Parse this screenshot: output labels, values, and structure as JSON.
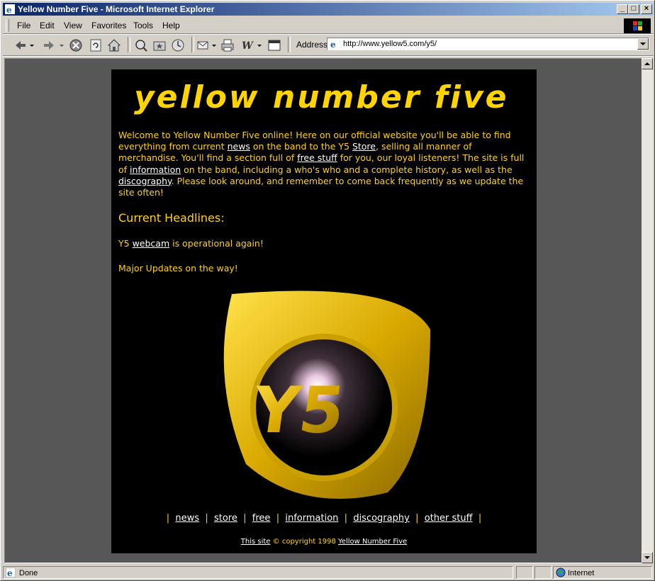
{
  "window": {
    "title": "Yellow Number Five - Microsoft Internet Explorer",
    "controls": {
      "minimize": "_",
      "maximize": "□",
      "close": "×"
    }
  },
  "menu": [
    "File",
    "Edit",
    "View",
    "Favorites",
    "Tools",
    "Help"
  ],
  "toolbar": {
    "address_label": "Address",
    "url": "http://www.yellow5.com/y5/"
  },
  "page": {
    "logo_text": "yellow number five",
    "welcome": {
      "p1": "Welcome to Yellow Number Five online! Here on our official website you'll be able to find everything from current ",
      "news_link": "news",
      "p2": " on the band to the Y5 ",
      "store_link": "Store",
      "p3": ", selling all manner of merchandise. You'll find a section full of ",
      "free_link": "free stuff",
      "p4": " for you, our loyal listeners! The site is full of ",
      "info_link": "information",
      "p5": " on the band, including a who's who and a complete history, as well as the ",
      "disco_link": "discography",
      "p6": ". Please look around, and remember to come back frequently as we update the site often!"
    },
    "headlines_title": "Current Headlines:",
    "headline1": {
      "pre": "Y5 ",
      "link": "webcam",
      "post": " is operational again!"
    },
    "headline2": "Major Updates on the way!",
    "nav": {
      "sep": "|",
      "items": [
        "news",
        "store",
        "free",
        "information",
        "discography",
        "other stuff"
      ]
    },
    "footer": {
      "site_link": "This site",
      "copyright": " © copyright 1998 ",
      "band_link": "Yellow Number Five"
    }
  },
  "status": {
    "text": "Done",
    "zone": "Internet"
  },
  "colors": {
    "accent": "#ffd400",
    "page_bg": "#000000",
    "viewport_bg": "#575757",
    "title_gradient_start": "#0a246a"
  }
}
